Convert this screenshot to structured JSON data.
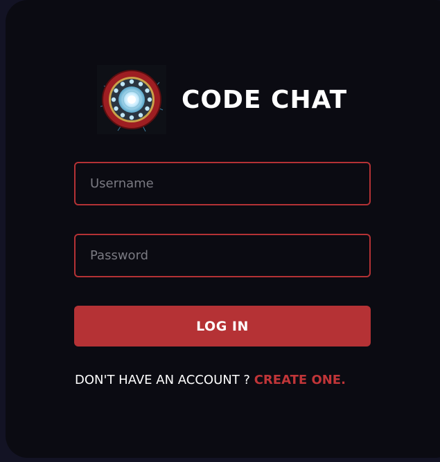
{
  "brand": {
    "title": "CODE CHAT",
    "logo_icon": "arc-reactor-icon"
  },
  "form": {
    "username_placeholder": "Username",
    "password_placeholder": "Password",
    "login_label": "LOG IN",
    "signup_prompt": "DON'T HAVE AN ACCOUNT ? ",
    "signup_link": "CREATE ONE."
  },
  "colors": {
    "accent": "#b53235",
    "card_background": "#0b0b12",
    "page_background": "#131324",
    "text": "#ffffff"
  }
}
